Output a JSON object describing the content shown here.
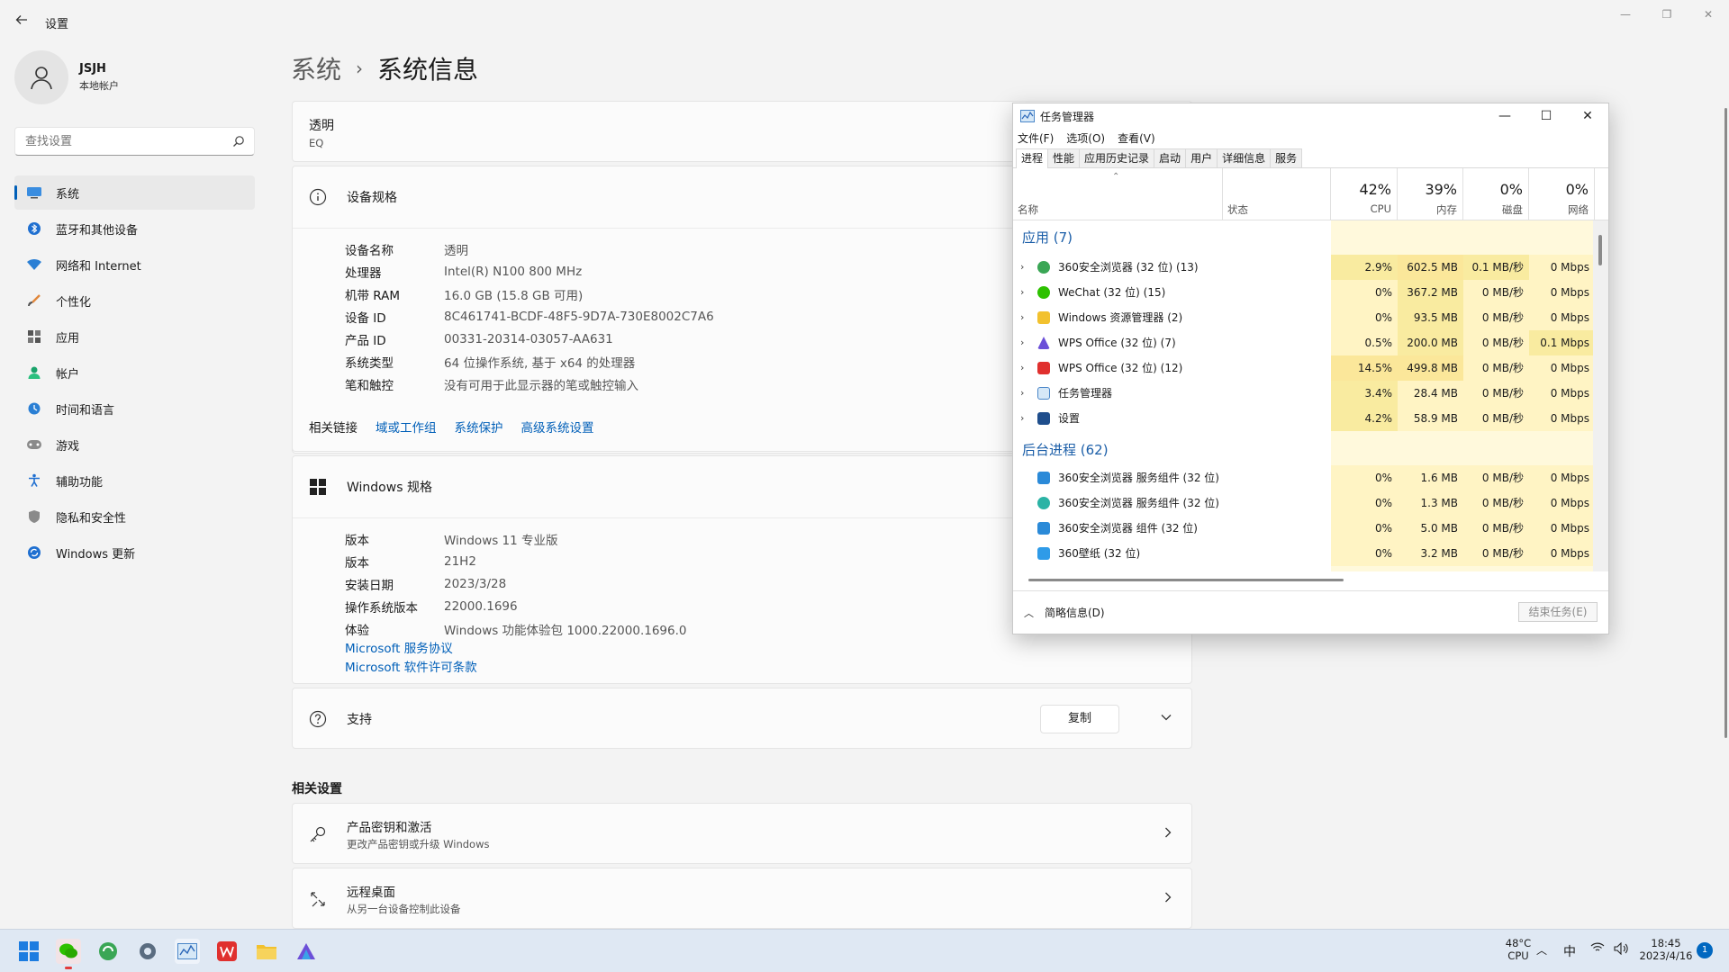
{
  "app": {
    "title": "设置",
    "back_label": "←"
  },
  "profile": {
    "name": "JSJH",
    "account_type": "本地帐户"
  },
  "search": {
    "placeholder": "查找设置"
  },
  "sidebar": {
    "items": [
      {
        "label": "系统",
        "icon": "system-icon",
        "active": true
      },
      {
        "label": "蓝牙和其他设备",
        "icon": "bluetooth-icon"
      },
      {
        "label": "网络和 Internet",
        "icon": "wifi-icon"
      },
      {
        "label": "个性化",
        "icon": "brush-icon"
      },
      {
        "label": "应用",
        "icon": "apps-icon"
      },
      {
        "label": "帐户",
        "icon": "account-icon"
      },
      {
        "label": "时间和语言",
        "icon": "globe-clock-icon"
      },
      {
        "label": "游戏",
        "icon": "gamepad-icon"
      },
      {
        "label": "辅助功能",
        "icon": "accessibility-icon"
      },
      {
        "label": "隐私和安全性",
        "icon": "shield-icon"
      },
      {
        "label": "Windows 更新",
        "icon": "update-icon"
      }
    ]
  },
  "breadcrumb": {
    "parent": "系统",
    "separator": "›",
    "current": "系统信息"
  },
  "device_card": {
    "name": "透明",
    "model": "EQ"
  },
  "device_specs": {
    "title": "设备规格",
    "rows": [
      {
        "label": "设备名称",
        "value": "透明"
      },
      {
        "label": "处理器",
        "value": "Intel(R) N100   800 MHz"
      },
      {
        "label": "机带 RAM",
        "value": "16.0 GB (15.8 GB 可用)"
      },
      {
        "label": "设备 ID",
        "value": "8C461741-BCDF-48F5-9D7A-730E8002C7A6"
      },
      {
        "label": "产品 ID",
        "value": "00331-20314-03057-AA631"
      },
      {
        "label": "系统类型",
        "value": "64 位操作系统, 基于 x64 的处理器"
      },
      {
        "label": "笔和触控",
        "value": "没有可用于此显示器的笔或触控输入"
      }
    ]
  },
  "related_links": {
    "label": "相关链接",
    "links": [
      "域或工作组",
      "系统保护",
      "高级系统设置"
    ]
  },
  "windows_specs": {
    "title": "Windows 规格",
    "rows": [
      {
        "label": "版本",
        "value": "Windows 11 专业版"
      },
      {
        "label": "版本",
        "value": "21H2"
      },
      {
        "label": "安装日期",
        "value": "2023/3/28"
      },
      {
        "label": "操作系统版本",
        "value": "22000.1696"
      },
      {
        "label": "体验",
        "value": "Windows 功能体验包 1000.22000.1696.0"
      }
    ],
    "links": [
      "Microsoft 服务协议",
      "Microsoft 软件许可条款"
    ]
  },
  "support": {
    "title": "支持",
    "copy_label": "复制"
  },
  "related_settings": {
    "title": "相关设置",
    "items": [
      {
        "title": "产品密钥和激活",
        "subtitle": "更改产品密钥或升级 Windows",
        "icon": "key-icon"
      },
      {
        "title": "远程桌面",
        "subtitle": "从另一台设备控制此设备",
        "icon": "remote-desktop-icon"
      }
    ]
  },
  "task_manager": {
    "title": "任务管理器",
    "menu": [
      "文件(F)",
      "选项(O)",
      "查看(V)"
    ],
    "tabs": [
      "进程",
      "性能",
      "应用历史记录",
      "启动",
      "用户",
      "详细信息",
      "服务"
    ],
    "columns": {
      "name": "名称",
      "status": "状态",
      "cpu": {
        "percent": "42%",
        "label": "CPU"
      },
      "memory": {
        "percent": "39%",
        "label": "内存"
      },
      "disk": {
        "percent": "0%",
        "label": "磁盘"
      },
      "network": {
        "percent": "0%",
        "label": "网络"
      }
    },
    "groups": [
      {
        "label": "应用 (7)",
        "rows": [
          {
            "name": "360安全浏览器 (32 位) (13)",
            "cpu": "2.9%",
            "mem": "602.5 MB",
            "disk": "0.1 MB/秒",
            "net": "0 Mbps",
            "icon_color": "#3aa655"
          },
          {
            "name": "WeChat (32 位) (15)",
            "cpu": "0%",
            "mem": "367.2 MB",
            "disk": "0 MB/秒",
            "net": "0 Mbps",
            "icon_color": "#2dc100"
          },
          {
            "name": "Windows 资源管理器 (2)",
            "cpu": "0%",
            "mem": "93.5 MB",
            "disk": "0 MB/秒",
            "net": "0 Mbps",
            "icon_color": "#f2c12e"
          },
          {
            "name": "WPS Office (32 位) (7)",
            "cpu": "0.5%",
            "mem": "200.0 MB",
            "disk": "0 MB/秒",
            "net": "0.1 Mbps",
            "icon_color": "#6b4fd8"
          },
          {
            "name": "WPS Office (32 位) (12)",
            "cpu": "14.5%",
            "mem": "499.8 MB",
            "disk": "0 MB/秒",
            "net": "0 Mbps",
            "icon_color": "#e0302e"
          },
          {
            "name": "任务管理器",
            "cpu": "3.4%",
            "mem": "28.4 MB",
            "disk": "0 MB/秒",
            "net": "0 Mbps",
            "icon_color": "#4a86c8"
          },
          {
            "name": "设置",
            "cpu": "4.2%",
            "mem": "58.9 MB",
            "disk": "0 MB/秒",
            "net": "0 Mbps",
            "icon_color": "#1f4e8c"
          }
        ]
      },
      {
        "label": "后台进程 (62)",
        "rows": [
          {
            "name": "360安全浏览器 服务组件 (32 位)",
            "cpu": "0%",
            "mem": "1.6 MB",
            "disk": "0 MB/秒",
            "net": "0 Mbps",
            "icon_color": "#2b8ad8"
          },
          {
            "name": "360安全浏览器 服务组件 (32 位)",
            "cpu": "0%",
            "mem": "1.3 MB",
            "disk": "0 MB/秒",
            "net": "0 Mbps",
            "icon_color": "#2bb3a5"
          },
          {
            "name": "360安全浏览器 组件 (32 位)",
            "cpu": "0%",
            "mem": "5.0 MB",
            "disk": "0 MB/秒",
            "net": "0 Mbps",
            "icon_color": "#2b8ad8"
          },
          {
            "name": "360壁纸 (32 位)",
            "cpu": "0%",
            "mem": "3.2 MB",
            "disk": "0 MB/秒",
            "net": "0 Mbps",
            "icon_color": "#2f9be8"
          }
        ]
      }
    ],
    "footer": {
      "fewer_details": "简略信息(D)",
      "end_task": "结束任务(E)"
    }
  },
  "taskbar": {
    "apps": [
      "start-icon",
      "wechat-icon",
      "browser-360-icon",
      "settings-icon",
      "task-manager-icon",
      "wps-icon",
      "file-explorer-icon",
      "wps-office-icon"
    ],
    "temperature": "48°C",
    "temperature_label": "CPU",
    "ime": "中",
    "time": "18:45",
    "date": "2023/4/16",
    "notification_count": "1"
  },
  "colors": {
    "accent": "#005fb8",
    "link": "#005fb8",
    "background": "#f3f3f3",
    "card": "#fbfbfb",
    "group_label": "#1b5ea8"
  }
}
